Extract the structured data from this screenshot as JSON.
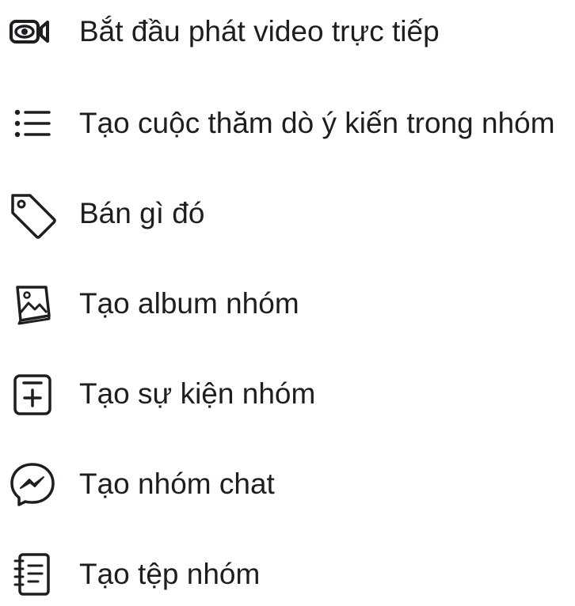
{
  "menu": {
    "items": [
      {
        "id": "live-video",
        "label": "Bắt đầu phát video trực tiếp",
        "icon": "live-video-camera-icon"
      },
      {
        "id": "poll",
        "label": "Tạo cuộc thăm dò ý kiến trong nhóm",
        "icon": "poll-list-icon"
      },
      {
        "id": "sell",
        "label": "Bán gì đó",
        "icon": "price-tag-icon"
      },
      {
        "id": "album",
        "label": "Tạo album nhóm",
        "icon": "photo-album-icon"
      },
      {
        "id": "event",
        "label": "Tạo sự kiện nhóm",
        "icon": "calendar-add-icon"
      },
      {
        "id": "chat",
        "label": "Tạo nhóm chat",
        "icon": "messenger-icon"
      },
      {
        "id": "file",
        "label": "Tạo tệp nhóm",
        "icon": "notebook-file-icon"
      }
    ]
  },
  "colors": {
    "icon_stroke": "#1c1e21",
    "text": "#1c1e21",
    "background": "#ffffff"
  }
}
